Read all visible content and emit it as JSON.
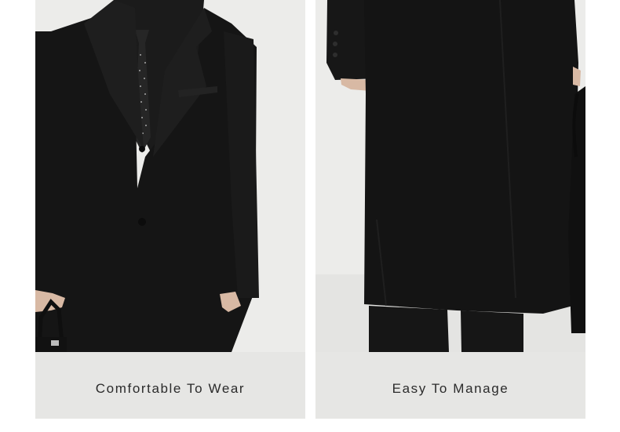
{
  "cards": [
    {
      "caption": "Comfortable To Wear",
      "image": "black-overcoat-front-with-tie"
    },
    {
      "caption": "Easy To Manage",
      "image": "black-overcoat-lower-detail-with-bag"
    }
  ],
  "colors": {
    "background": "#ffffff",
    "card": "#e6e6e4",
    "photo_backdrop": "#ececea",
    "coat": "#161616",
    "caption_text": "#2b2b2b"
  }
}
